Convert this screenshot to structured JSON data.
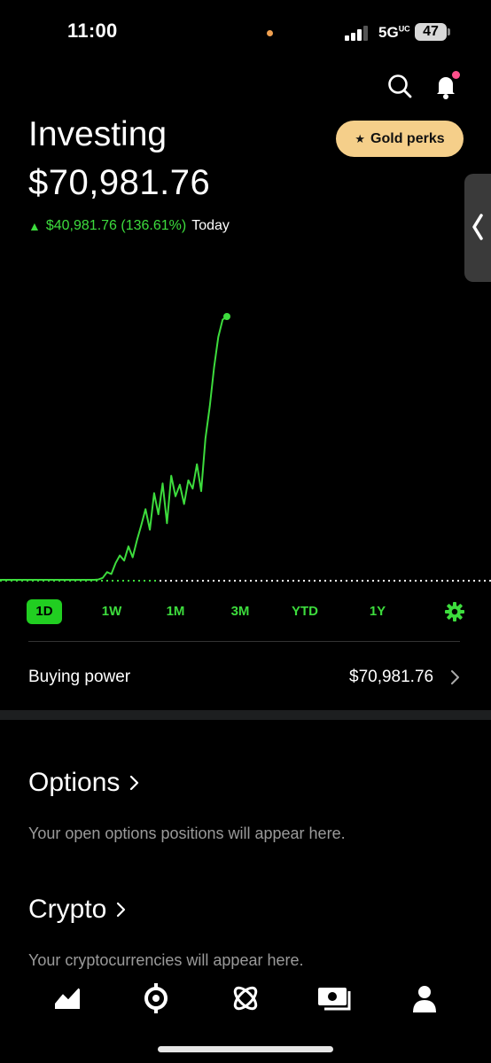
{
  "status_bar": {
    "time": "11:00",
    "network": "5G",
    "network_sup": "UC",
    "battery": "47"
  },
  "header": {
    "gold_perks_label": "Gold perks",
    "gold_star": "★"
  },
  "portfolio": {
    "title": "Investing",
    "balance": "$70,981.76",
    "change_arrow": "▲",
    "change": "$40,981.76 (136.61%)",
    "change_period": "Today"
  },
  "chart_data": {
    "type": "line",
    "title": "",
    "xlabel": "",
    "ylabel": "",
    "series": [
      {
        "values": [
          30000,
          30000,
          30000,
          30000,
          30000,
          30000,
          30000,
          30000,
          30000,
          30000,
          30000,
          30000,
          30000,
          30000,
          30000,
          30000,
          30000,
          30000,
          30000,
          30000,
          30000,
          30000,
          30000,
          30050,
          30300,
          31200,
          30900,
          32600,
          33800,
          33000,
          35200,
          33500,
          36200,
          38500,
          41000,
          37800,
          43500,
          40200,
          45000,
          38800,
          46200,
          43000,
          44800,
          41800,
          45500,
          44200,
          48000,
          43800,
          52000,
          57000,
          63000,
          67800,
          70500,
          70981.76
        ]
      }
    ],
    "baseline": 30000,
    "colors": {
      "line": "#3ddc3d",
      "baseline": "#3ddc3d",
      "future": "#ffffff"
    }
  },
  "ranges": [
    "1D",
    "1W",
    "1M",
    "3M",
    "YTD",
    "1Y"
  ],
  "active_range": "1D",
  "buying_power": {
    "label": "Buying power",
    "value": "$70,981.76"
  },
  "options": {
    "title": "Options",
    "subtitle": "Your open options positions will appear here."
  },
  "crypto": {
    "title": "Crypto",
    "subtitle": "Your cryptocurrencies will appear here."
  },
  "nav": {
    "items": [
      "investing-chart-icon",
      "browse-icon",
      "crypto-icon",
      "cash-icon",
      "account-icon"
    ]
  },
  "colors": {
    "accent_green": "#3ddc3d",
    "gold": "#f5cf8a",
    "background": "#000000",
    "bell_badge": "#ff4f8b",
    "status_dot": "#f0a050"
  }
}
